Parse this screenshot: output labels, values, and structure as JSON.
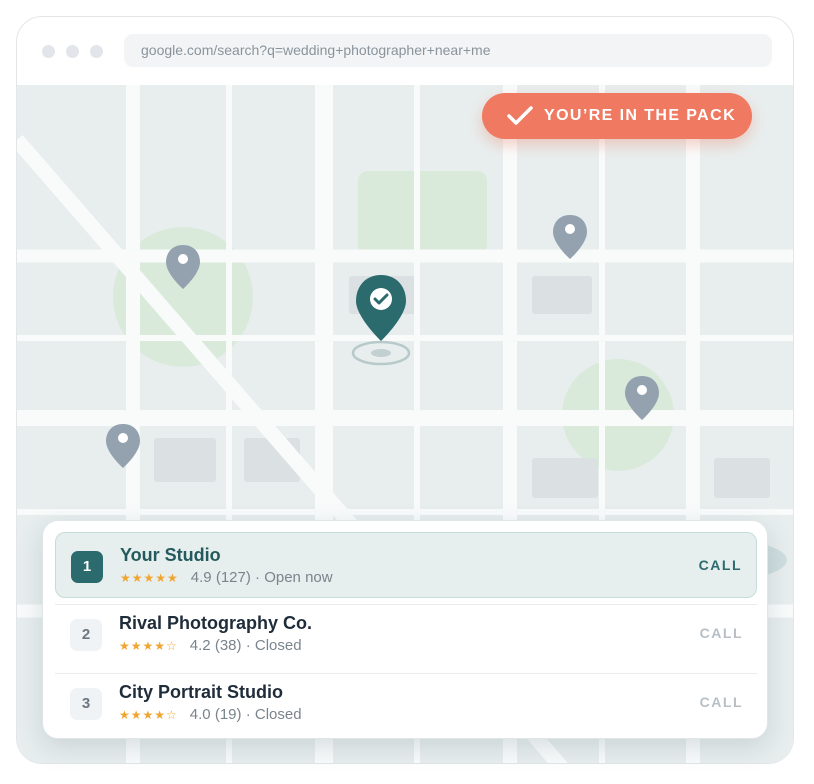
{
  "browser": {
    "url": "google.com/search?q=wedding+photographer+near+me"
  },
  "badge": {
    "label": "YOU’RE IN THE PACK",
    "icon": "checkmark-icon",
    "color": "#ef7a61"
  },
  "map": {
    "selected_pin_icon": "check-map-pin-icon",
    "other_pin_icon": "map-pin-icon",
    "selected_pin_color": "#2b6a6d",
    "pin_color": "#93a2ae"
  },
  "results": [
    {
      "rank": "1",
      "name": "Your Studio",
      "stars": "★★★★★",
      "rating": "4.9",
      "reviews": "(127)",
      "separator": "·",
      "status": "Open now",
      "call_label": "CALL",
      "highlighted": true
    },
    {
      "rank": "2",
      "name": "Rival Photography Co.",
      "stars": "★★★★☆",
      "rating": "4.2",
      "reviews": "(38)",
      "separator": "·",
      "status": "Closed",
      "call_label": "CALL",
      "highlighted": false
    },
    {
      "rank": "3",
      "name": "City Portrait Studio",
      "stars": "★★★★☆",
      "rating": "4.0",
      "reviews": "(19)",
      "separator": "·",
      "status": "Closed",
      "call_label": "CALL",
      "highlighted": false
    }
  ],
  "colors": {
    "accent": "#2b6a6d",
    "star": "#f0a530",
    "map_background": "#e8eeee",
    "park": "#d9eadb"
  }
}
